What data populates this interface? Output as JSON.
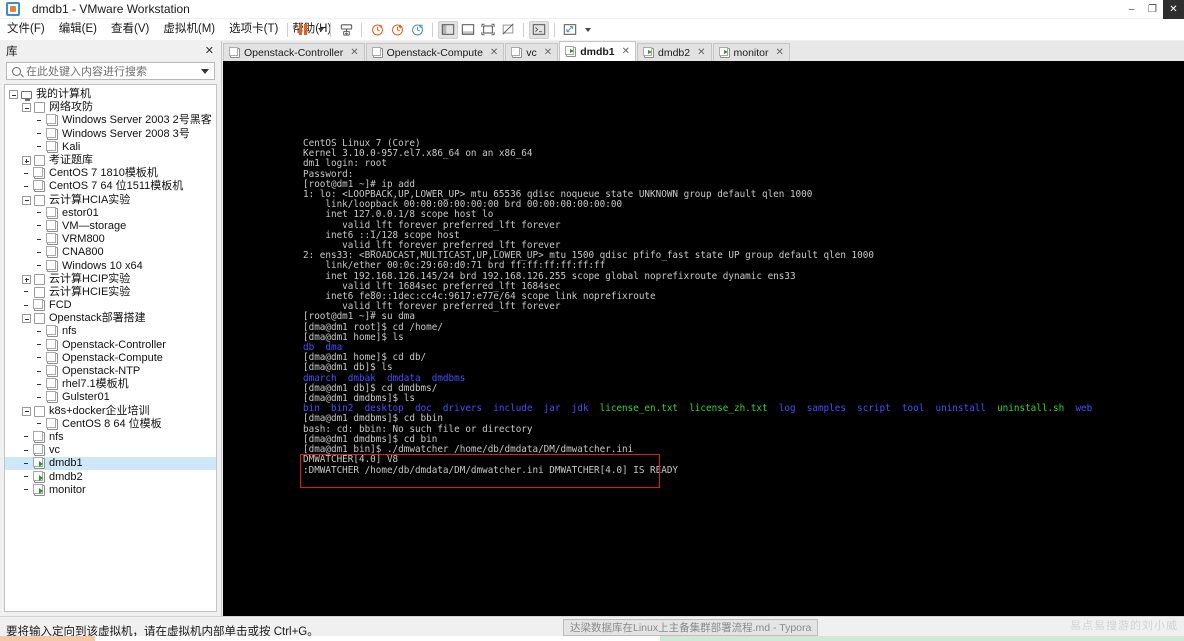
{
  "window": {
    "title": "dmdb1 - VMware Workstation",
    "app_icon": "vmware-icon",
    "minimize": "–",
    "maximize": "❐",
    "close": "✕"
  },
  "menu": [
    {
      "label": "文件(F)",
      "name": "menu-file"
    },
    {
      "label": "编辑(E)",
      "name": "menu-edit"
    },
    {
      "label": "查看(V)",
      "name": "menu-view"
    },
    {
      "label": "虚拟机(M)",
      "name": "menu-vm"
    },
    {
      "label": "选项卡(T)",
      "name": "menu-tabs"
    },
    {
      "label": "帮助(H)",
      "name": "menu-help"
    }
  ],
  "toolbar": [
    {
      "name": "pause-button",
      "icon": "pause-icon"
    },
    {
      "name": "power-dropdown",
      "icon": "chevron-down-icon"
    },
    {
      "name": "send-ctrl-alt-del-button",
      "icon": "keyboard-send-icon"
    },
    {
      "name": "snapshot-take-button",
      "icon": "snapshot-clock-plus-icon"
    },
    {
      "name": "snapshot-revert-button",
      "icon": "snapshot-revert-icon"
    },
    {
      "name": "snapshot-manager-button",
      "icon": "snapshot-manager-icon"
    },
    {
      "name": "show-library-button",
      "icon": "panel-left-icon"
    },
    {
      "name": "show-thumbnails-button",
      "icon": "panel-bottom-icon"
    },
    {
      "name": "fullscreen-button",
      "icon": "fullscreen-icon"
    },
    {
      "name": "unity-mode-button",
      "icon": "unity-icon"
    },
    {
      "name": "console-button",
      "icon": "console-icon"
    },
    {
      "name": "stretch-button",
      "icon": "stretch-arrows-icon"
    },
    {
      "name": "stretch-dropdown",
      "icon": "chevron-down-icon"
    }
  ],
  "library": {
    "title": "库",
    "close_label": "✕",
    "search": {
      "placeholder": "在此处键入内容进行搜索",
      "value": ""
    },
    "tree": [
      {
        "label": "我的计算机",
        "depth": 0,
        "toggle": "minus",
        "icon": "computer-icon",
        "selected": false
      },
      {
        "label": "网络攻防",
        "depth": 1,
        "toggle": "minus",
        "icon": "folder-icon",
        "selected": false
      },
      {
        "label": "Windows Server 2003 2号黑客",
        "depth": 2,
        "toggle": "none",
        "icon": "vm-icon",
        "selected": false
      },
      {
        "label": "Windows Server 2008 3号",
        "depth": 2,
        "toggle": "none",
        "icon": "vm-icon",
        "selected": false
      },
      {
        "label": "Kali",
        "depth": 2,
        "toggle": "none",
        "icon": "vm-icon",
        "selected": false
      },
      {
        "label": "考证题库",
        "depth": 1,
        "toggle": "plus",
        "icon": "folder-icon",
        "selected": false
      },
      {
        "label": "CentOS 7 1810模板机",
        "depth": 1,
        "toggle": "none",
        "icon": "vm-icon",
        "selected": false
      },
      {
        "label": "CentOS 7 64 位1511模板机",
        "depth": 1,
        "toggle": "none",
        "icon": "vm-icon",
        "selected": false
      },
      {
        "label": "云计算HCIA实验",
        "depth": 1,
        "toggle": "minus",
        "icon": "folder-icon",
        "selected": false
      },
      {
        "label": "estor01",
        "depth": 2,
        "toggle": "none",
        "icon": "vm-icon",
        "selected": false
      },
      {
        "label": "VM—storage",
        "depth": 2,
        "toggle": "none",
        "icon": "vm-icon",
        "selected": false
      },
      {
        "label": "VRM800",
        "depth": 2,
        "toggle": "none",
        "icon": "vm-icon",
        "selected": false
      },
      {
        "label": "CNA800",
        "depth": 2,
        "toggle": "none",
        "icon": "vm-icon",
        "selected": false
      },
      {
        "label": "Windows 10 x64",
        "depth": 2,
        "toggle": "none",
        "icon": "vm-icon",
        "selected": false
      },
      {
        "label": "云计算HCIP实验",
        "depth": 1,
        "toggle": "plus",
        "icon": "folder-icon",
        "selected": false
      },
      {
        "label": "云计算HCIE实验",
        "depth": 1,
        "toggle": "none",
        "icon": "folder-icon",
        "selected": false
      },
      {
        "label": "FCD",
        "depth": 1,
        "toggle": "none",
        "icon": "vm-icon",
        "selected": false
      },
      {
        "label": "Openstack部署搭建",
        "depth": 1,
        "toggle": "minus",
        "icon": "folder-icon",
        "selected": false
      },
      {
        "label": "nfs",
        "depth": 2,
        "toggle": "none",
        "icon": "vm-icon",
        "selected": false
      },
      {
        "label": "Openstack-Controller",
        "depth": 2,
        "toggle": "none",
        "icon": "vm-icon",
        "selected": false
      },
      {
        "label": "Openstack-Compute",
        "depth": 2,
        "toggle": "none",
        "icon": "vm-icon",
        "selected": false
      },
      {
        "label": "Openstack-NTP",
        "depth": 2,
        "toggle": "none",
        "icon": "vm-icon",
        "selected": false
      },
      {
        "label": "rhel7.1模板机",
        "depth": 2,
        "toggle": "none",
        "icon": "vm-icon",
        "selected": false
      },
      {
        "label": "Gulster01",
        "depth": 2,
        "toggle": "none",
        "icon": "vm-icon",
        "selected": false
      },
      {
        "label": "k8s+docker企业培训",
        "depth": 1,
        "toggle": "minus",
        "icon": "folder-icon",
        "selected": false
      },
      {
        "label": "CentOS 8 64 位模板",
        "depth": 2,
        "toggle": "none",
        "icon": "vm-icon",
        "selected": false
      },
      {
        "label": "nfs",
        "depth": 1,
        "toggle": "none",
        "icon": "vm-icon",
        "selected": false
      },
      {
        "label": "vc",
        "depth": 1,
        "toggle": "none",
        "icon": "vm-icon",
        "selected": false
      },
      {
        "label": "dmdb1",
        "depth": 1,
        "toggle": "none",
        "icon": "vm-running-icon",
        "selected": true
      },
      {
        "label": "dmdb2",
        "depth": 1,
        "toggle": "none",
        "icon": "vm-running-icon",
        "selected": false
      },
      {
        "label": "monitor",
        "depth": 1,
        "toggle": "none",
        "icon": "vm-running-icon",
        "selected": false
      }
    ]
  },
  "tabs": [
    {
      "label": "Openstack-Controller",
      "active": false,
      "running": false,
      "close": "✕"
    },
    {
      "label": "Openstack-Compute",
      "active": false,
      "running": false,
      "close": "✕"
    },
    {
      "label": "vc",
      "active": false,
      "running": false,
      "close": "✕"
    },
    {
      "label": "dmdb1",
      "active": true,
      "running": true,
      "close": "✕"
    },
    {
      "label": "dmdb2",
      "active": false,
      "running": true,
      "close": "✕"
    },
    {
      "label": "monitor",
      "active": false,
      "running": true,
      "close": "✕"
    }
  ],
  "terminal": {
    "lines": [
      {
        "segments": [
          {
            "t": "CentOS Linux 7 (Core)",
            "c": ""
          }
        ]
      },
      {
        "segments": [
          {
            "t": "Kernel 3.10.0-957.el7.x86_64 on an x86_64",
            "c": ""
          }
        ]
      },
      {
        "segments": [
          {
            "t": "",
            "c": ""
          }
        ]
      },
      {
        "segments": [
          {
            "t": "dm1 login: root",
            "c": ""
          }
        ]
      },
      {
        "segments": [
          {
            "t": "Password:",
            "c": ""
          }
        ]
      },
      {
        "segments": [
          {
            "t": "[root@dm1 ~]# ip add",
            "c": ""
          }
        ]
      },
      {
        "segments": [
          {
            "t": "1: lo: <LOOPBACK,UP,LOWER_UP> mtu 65536 qdisc noqueue state UNKNOWN group default qlen 1000",
            "c": ""
          }
        ]
      },
      {
        "segments": [
          {
            "t": "    link/loopback 00:00:00:00:00:00 brd 00:00:00:00:00:00",
            "c": ""
          }
        ]
      },
      {
        "segments": [
          {
            "t": "    inet 127.0.0.1/8 scope host lo",
            "c": ""
          }
        ]
      },
      {
        "segments": [
          {
            "t": "       valid_lft forever preferred_lft forever",
            "c": ""
          }
        ]
      },
      {
        "segments": [
          {
            "t": "    inet6 ::1/128 scope host",
            "c": ""
          }
        ]
      },
      {
        "segments": [
          {
            "t": "       valid_lft forever preferred_lft forever",
            "c": ""
          }
        ]
      },
      {
        "segments": [
          {
            "t": "2: ens33: <BROADCAST,MULTICAST,UP,LOWER_UP> mtu 1500 qdisc pfifo_fast state UP group default qlen 1000",
            "c": ""
          }
        ]
      },
      {
        "segments": [
          {
            "t": "    link/ether 00:0c:29:60:d0:71 brd ff:ff:ff:ff:ff:ff",
            "c": ""
          }
        ]
      },
      {
        "segments": [
          {
            "t": "    inet 192.168.126.145/24 brd 192.168.126.255 scope global noprefixroute dynamic ens33",
            "c": ""
          }
        ]
      },
      {
        "segments": [
          {
            "t": "       valid_lft 1684sec preferred_lft 1684sec",
            "c": ""
          }
        ]
      },
      {
        "segments": [
          {
            "t": "    inet6 fe80::1dec:cc4c:9617:e77e/64 scope link noprefixroute",
            "c": ""
          }
        ]
      },
      {
        "segments": [
          {
            "t": "       valid_lft forever preferred_lft forever",
            "c": ""
          }
        ]
      },
      {
        "segments": [
          {
            "t": "[root@dm1 ~]# su dma",
            "c": ""
          }
        ]
      },
      {
        "segments": [
          {
            "t": "[dma@dm1 root]$ cd /home/",
            "c": ""
          }
        ]
      },
      {
        "segments": [
          {
            "t": "[dma@dm1 home]$ ls",
            "c": ""
          }
        ]
      },
      {
        "segments": [
          {
            "t": "db  dma",
            "c": "blue"
          }
        ]
      },
      {
        "segments": [
          {
            "t": "[dma@dm1 home]$ cd db/",
            "c": ""
          }
        ]
      },
      {
        "segments": [
          {
            "t": "[dma@dm1 db]$ ls",
            "c": ""
          }
        ]
      },
      {
        "segments": [
          {
            "t": "dmarch  dmbak  dmdata  dmdbms",
            "c": "blue"
          }
        ]
      },
      {
        "segments": [
          {
            "t": "[dma@dm1 db]$ cd dmdbms/",
            "c": ""
          }
        ]
      },
      {
        "segments": [
          {
            "t": "[dma@dm1 dmdbms]$ ls",
            "c": ""
          }
        ]
      },
      {
        "segments": [
          {
            "t": "bin  bin2  desktop  doc  drivers  include  jar  jdk  ",
            "c": "blue"
          },
          {
            "t": "license_en.txt  license_zh.txt",
            "c": "green"
          },
          {
            "t": "  log  samples  script  tool  uninstall  ",
            "c": "blue"
          },
          {
            "t": "uninstall.sh",
            "c": "green"
          },
          {
            "t": "  web",
            "c": "blue"
          }
        ]
      },
      {
        "segments": [
          {
            "t": "[dma@dm1 dmdbms]$ cd bbin",
            "c": ""
          }
        ]
      },
      {
        "segments": [
          {
            "t": "bash: cd: bbin: No such file or directory",
            "c": ""
          }
        ]
      },
      {
        "segments": [
          {
            "t": "[dma@dm1 dmdbms]$ cd bin",
            "c": ""
          }
        ]
      },
      {
        "segments": [
          {
            "t": "[dma@dm1 bin]$ ./dmwatcher /home/db/dmdata/DM/dmwatcher.ini",
            "c": ""
          }
        ]
      },
      {
        "segments": [
          {
            "t": "DMWATCHER[4.0] V8",
            "c": ""
          }
        ]
      },
      {
        "segments": [
          {
            "t": ":DMWATCHER /home/db/dmdata/DM/dmwatcher.ini DMWATCHER[4.0] IS READY",
            "c": ""
          }
        ]
      }
    ],
    "highlight_box": {
      "color": "#e01b1b"
    }
  },
  "statusbar": {
    "hint": "要将输入定向到该虚拟机，请在虚拟机内部单击或按 Ctrl+G。",
    "taskbar_item": "达梁数据库在Linux上主备集群部署流程.md - Typora",
    "watermark": "易点易搜游的刘小威"
  }
}
